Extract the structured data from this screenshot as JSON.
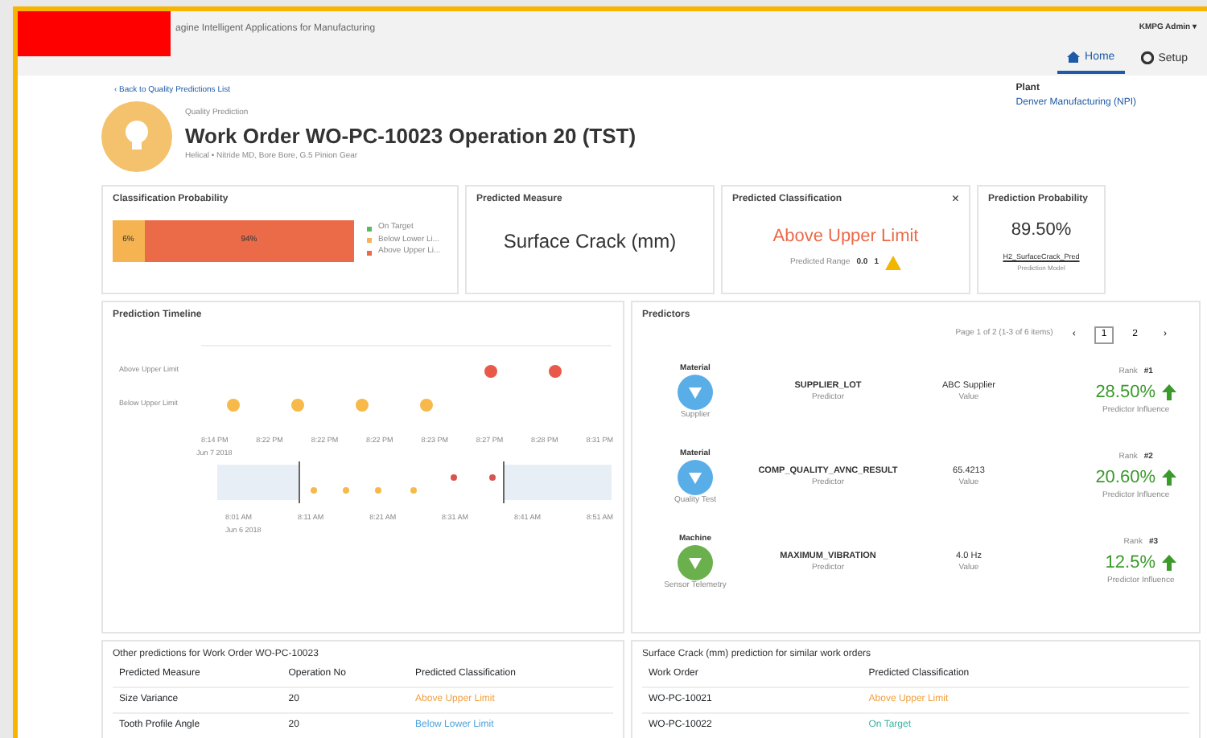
{
  "header": {
    "app_title": "agine Intelligent Applications for Manufacturing",
    "user": "KMPG Admin ▾",
    "tabs": [
      {
        "label": "Home",
        "selected": true
      },
      {
        "label": "Setup",
        "selected": false
      }
    ]
  },
  "back_link": "‹ Back to Quality Predictions List",
  "plant": {
    "label": "Plant",
    "value": "Denver Manufacturing (NPI)"
  },
  "title_block": {
    "eyebrow": "Quality Prediction",
    "title": "Work Order WO-PC-10023 Operation 20 (TST)",
    "subtitle": "Helical • Nitride MD, Bore Bore, G.5 Pinion Gear"
  },
  "cards": [
    {
      "kind": "probability",
      "title": "Classification Probability",
      "segments": [
        {
          "label": "6%",
          "color": "#f6b352"
        },
        {
          "label": "94%",
          "color": "#eb6a48"
        }
      ],
      "legend": [
        {
          "label": "On Target",
          "color": "#5cb85c"
        },
        {
          "label": "Below Lower Li...",
          "color": "#f6b352"
        },
        {
          "label": "Above Upper Li...",
          "color": "#eb6a48"
        }
      ]
    },
    {
      "kind": "measure",
      "title": "Predicted Measure",
      "value": "Surface Crack (mm)"
    },
    {
      "kind": "classification",
      "title": "Predicted Classification",
      "close": "×",
      "value": "Above Upper Limit",
      "range_label": "Predicted Range",
      "range_low": "0.0",
      "range_high": "1"
    },
    {
      "kind": "model",
      "title": "Prediction Probability",
      "value": "89.50%",
      "model": "H2_SurfaceCrack_Pred",
      "model_label": "Prediction Model"
    }
  ],
  "timeline": {
    "title": "Prediction Timeline",
    "lanes": [
      "Above Upper Limit",
      "Below Upper Limit"
    ],
    "ticks": [
      "8:14 PM",
      "8:22 PM",
      "8:22 PM",
      "8:22 PM",
      "8:23 PM",
      "8:27 PM",
      "8:28 PM",
      "8:31 PM"
    ],
    "date": "Jun 7 2018",
    "overview_ticks": [
      "8:01 AM",
      "8:11 AM",
      "8:21 AM",
      "8:31 AM",
      "8:41 AM",
      "8:51 AM"
    ],
    "overview_date": "Jun 6 2018"
  },
  "predictors": {
    "title": "Predictors",
    "pager": "Page 1 of 2 (1-3 of 6 items)",
    "pages": [
      {
        "label": "1",
        "selected": true
      },
      {
        "label": "2",
        "selected": false
      }
    ],
    "prev": "‹",
    "next": "›",
    "rows": [
      {
        "category": "Material",
        "source": "Supplier",
        "color": "#5aaee8",
        "name": "SUPPLIER_LOT",
        "name_label": "Predictor",
        "value": "ABC Supplier",
        "value_label": "Value",
        "rank_label": "Rank",
        "rank": "#1",
        "influence": "28.50%",
        "influence_label": "Predictor Influence"
      },
      {
        "category": "Material",
        "source": "Quality Test",
        "color": "#5aaee8",
        "name": "COMP_QUALITY_AVNC_RESULT",
        "name_label": "Predictor",
        "value": "65.4213",
        "value_label": "Value",
        "rank_label": "Rank",
        "rank": "#2",
        "influence": "20.60%",
        "influence_label": "Predictor Influence"
      },
      {
        "category": "Machine",
        "source": "Sensor Telemetry",
        "color": "#6ab04c",
        "name": "MAXIMUM_VIBRATION",
        "name_label": "Predictor",
        "value": "4.0 Hz",
        "value_label": "Value",
        "rank_label": "Rank",
        "rank": "#3",
        "influence": "12.5%",
        "influence_label": "Predictor Influence"
      }
    ]
  },
  "other_predictions": {
    "title": "Other predictions for Work Order WO-PC-10023",
    "columns": [
      "Predicted Measure",
      "Operation No",
      "Predicted Classification"
    ],
    "rows": [
      {
        "cells": [
          "Size Variance",
          "20",
          "Above Upper Limit"
        ],
        "color": "#f0a040"
      },
      {
        "cells": [
          "Tooth Profile Angle",
          "20",
          "Below Lower Limit"
        ],
        "color": "#4aa3df"
      }
    ]
  },
  "similar": {
    "title": "Surface Crack (mm) prediction for similar work orders",
    "columns": [
      "Work Order",
      "Predicted Classification"
    ],
    "rows": [
      {
        "cells": [
          "WO-PC-10021",
          "Above Upper Limit"
        ],
        "color": "#f0a040"
      },
      {
        "cells": [
          "WO-PC-10022",
          "On Target"
        ],
        "color": "#3bb3a0"
      }
    ]
  }
}
